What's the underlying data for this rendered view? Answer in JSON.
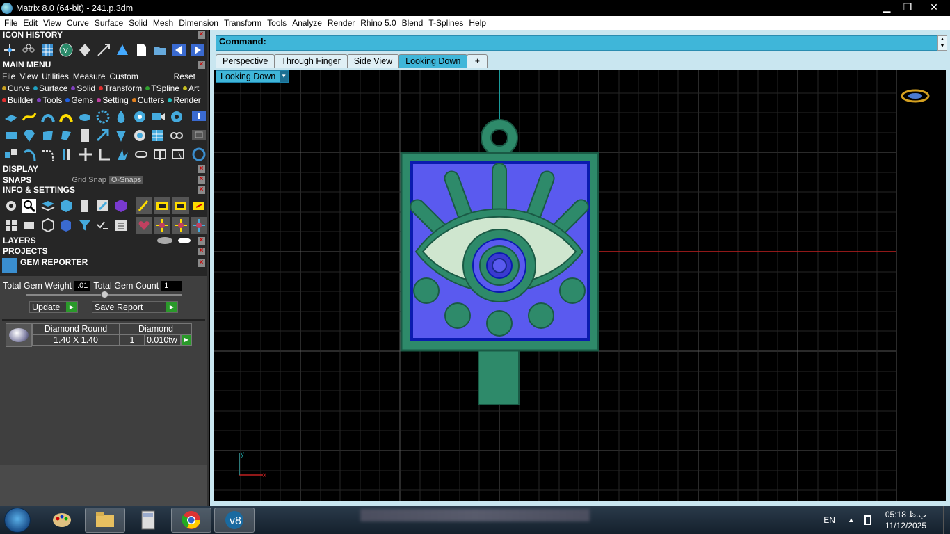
{
  "window": {
    "title": "Matrix 8.0 (64-bit) - 241.p.3dm",
    "min_label": "▁",
    "max_label": "❐",
    "close_label": "✕"
  },
  "menubar": [
    "File",
    "Edit",
    "View",
    "Curve",
    "Surface",
    "Solid",
    "Mesh",
    "Dimension",
    "Transform",
    "Tools",
    "Analyze",
    "Render",
    "Rhino 5.0",
    "Blend",
    "T-Splines",
    "Help"
  ],
  "panel": {
    "icon_history": "ICON HISTORY",
    "main_menu": "MAIN MENU",
    "main_tabs": [
      "File",
      "View",
      "Utilities",
      "Measure",
      "Custom"
    ],
    "reset": "Reset",
    "row1": [
      {
        "label": "Curve",
        "color": "#c8a020"
      },
      {
        "label": "Surface",
        "color": "#20a0c0"
      },
      {
        "label": "Solid",
        "color": "#8040c0"
      },
      {
        "label": "Transform",
        "color": "#e03030"
      },
      {
        "label": "TSpline",
        "color": "#30a030"
      },
      {
        "label": "Art",
        "color": "#c8c020"
      }
    ],
    "row2": [
      {
        "label": "Builder",
        "color": "#e03030"
      },
      {
        "label": "Tools",
        "color": "#8040c0"
      },
      {
        "label": "Gems",
        "color": "#2060e0"
      },
      {
        "label": "Setting",
        "color": "#c040a0"
      },
      {
        "label": "Cutters",
        "color": "#e08020"
      },
      {
        "label": "Render",
        "color": "#20c0c0"
      }
    ],
    "display": "DISPLAY",
    "snaps": "SNAPS",
    "grid_snap": "Grid Snap",
    "osnaps": "O-Snaps",
    "info_settings": "INFO & SETTINGS",
    "layers": "LAYERS",
    "projects": "PROJECTS",
    "gem_reporter": "GEM REPORTER",
    "total_gem_weight_label": "Total Gem Weight",
    "total_gem_weight": ".01",
    "total_gem_count_label": "Total Gem Count",
    "total_gem_count": "1",
    "update": "Update",
    "save_report": "Save Report",
    "table": {
      "headers": [
        "Diamond Round",
        "Diamond"
      ],
      "rows": [
        {
          "size": "1.40 X 1.40",
          "qty": "1",
          "weight": "0.010tw"
        }
      ]
    }
  },
  "command": {
    "label": "Command:"
  },
  "tabs": [
    "Perspective",
    "Through Finger",
    "Side View",
    "Looking Down",
    "+"
  ],
  "active_tab": "Looking Down",
  "viewport": {
    "label": "Looking Down",
    "axis_y": "y",
    "axis_x": "x"
  },
  "taskbar": {
    "lang": "EN",
    "time": "05:18 ب.ظ",
    "date": "11/12/2025"
  },
  "colors": {
    "accent": "#3fb6d9",
    "panel_dark": "#262626",
    "pendant_green": "#2e8a6a",
    "pendant_blue": "#5a5aef",
    "eye_white": "#cfe6cf"
  }
}
